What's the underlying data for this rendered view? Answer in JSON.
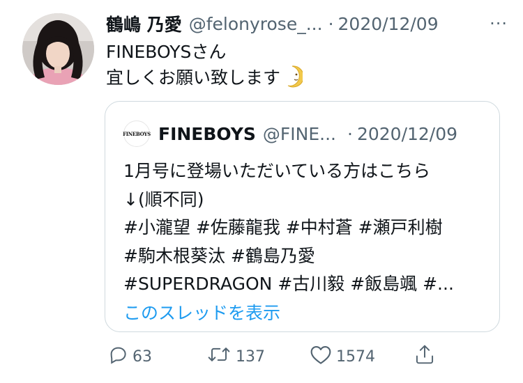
{
  "tweet": {
    "author_name": "鶴嶋 乃愛",
    "author_handle": "@felonyrose_...",
    "separator": "·",
    "date": "2020/12/09",
    "more_label": "···",
    "lines": [
      "FINEBOYSさん",
      "宜しくお願い致します"
    ],
    "emoji": "crescent-moon-face-icon"
  },
  "quote": {
    "avatar_text": "FINEBOYS",
    "author_name": "FINEBOYS",
    "author_handle": "@FINE...",
    "separator": "·",
    "date": "2020/12/09",
    "lines": [
      "1月号に登場いただいている方はこちら",
      "↓(順不同)",
      "#小瀧望 #佐藤龍我 #中村蒼 #瀬戸利樹",
      "#駒木根葵汰 #鶴島乃愛",
      "#SUPERDRAGON #古川毅 #飯島颯 #..."
    ],
    "show_thread": "このスレッドを表示"
  },
  "actions": {
    "reply_count": "63",
    "retweet_count": "137",
    "like_count": "1574"
  },
  "colors": {
    "text": "#0f1419",
    "secondary": "#536471",
    "link": "#1d9bf0",
    "border": "#cfd9de"
  }
}
